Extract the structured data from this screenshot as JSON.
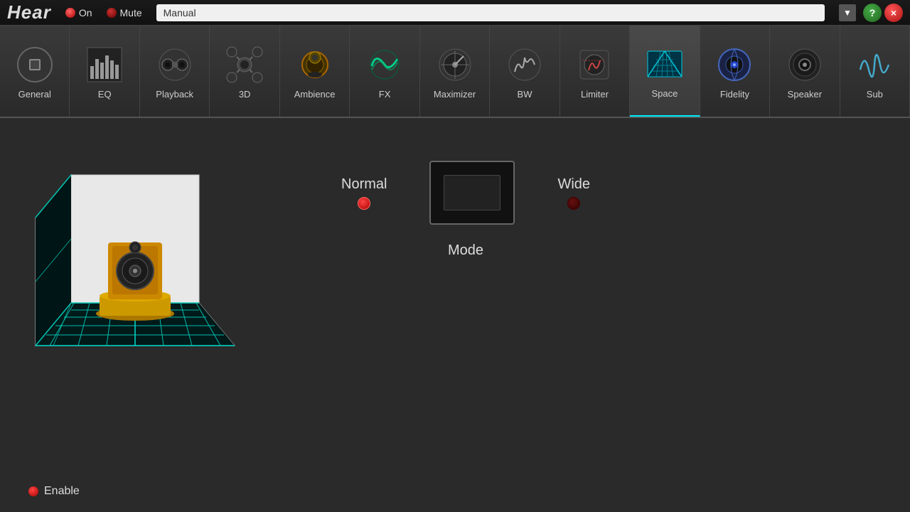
{
  "header": {
    "title": "Hear",
    "on_label": "On",
    "mute_label": "Mute",
    "profile": "Manual",
    "help_icon": "?",
    "close_icon": "×"
  },
  "tabs": [
    {
      "id": "general",
      "label": "General",
      "active": false
    },
    {
      "id": "eq",
      "label": "EQ",
      "active": false
    },
    {
      "id": "playback",
      "label": "Playback",
      "active": false
    },
    {
      "id": "3d",
      "label": "3D",
      "active": false
    },
    {
      "id": "ambience",
      "label": "Ambience",
      "active": false
    },
    {
      "id": "fx",
      "label": "FX",
      "active": false
    },
    {
      "id": "maximizer",
      "label": "Maximizer",
      "active": false
    },
    {
      "id": "bw",
      "label": "BW",
      "active": false
    },
    {
      "id": "limiter",
      "label": "Limiter",
      "active": false
    },
    {
      "id": "space",
      "label": "Space",
      "active": true
    },
    {
      "id": "fidelity",
      "label": "Fidelity",
      "active": false
    },
    {
      "id": "speaker",
      "label": "Speaker",
      "active": false
    },
    {
      "id": "sub",
      "label": "Sub",
      "active": false
    }
  ],
  "space": {
    "normal_label": "Normal",
    "wide_label": "Wide",
    "mode_label": "Mode",
    "enable_label": "Enable",
    "normal_active": true,
    "wide_active": false
  }
}
